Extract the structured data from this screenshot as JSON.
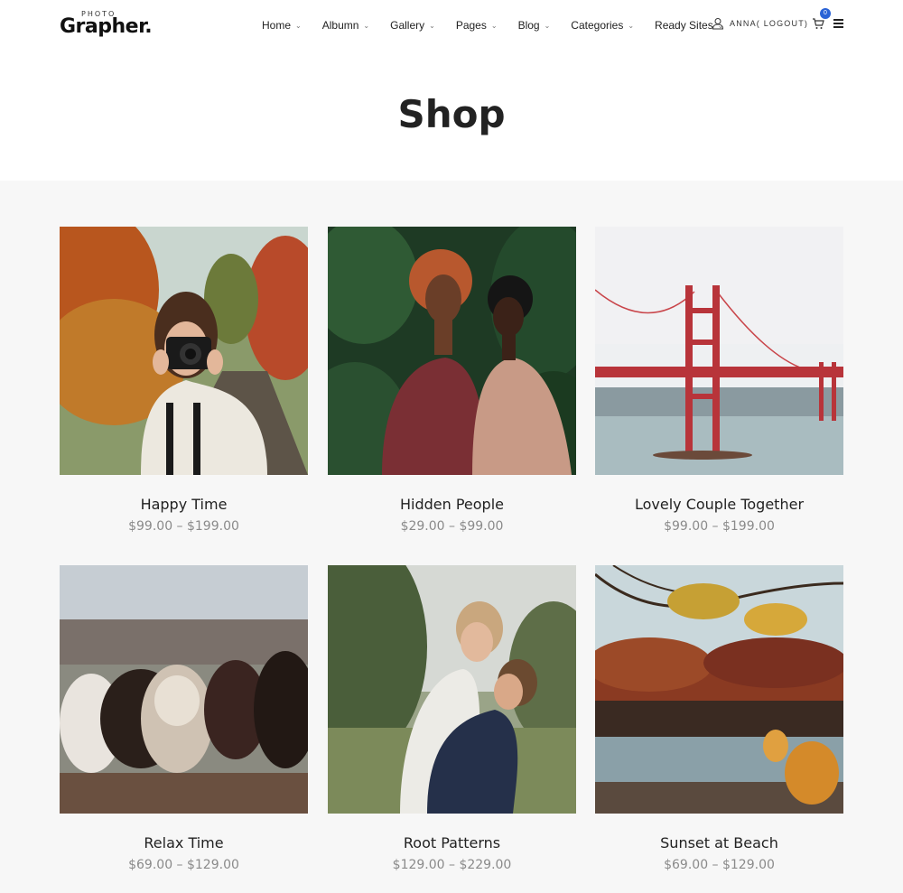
{
  "brand": {
    "small": "PHOTO",
    "name": "Grapher."
  },
  "nav": [
    {
      "label": "Home"
    },
    {
      "label": "Albumn"
    },
    {
      "label": "Gallery"
    },
    {
      "label": "Pages"
    },
    {
      "label": "Blog"
    },
    {
      "label": "Categories"
    },
    {
      "label": "Ready Sites"
    }
  ],
  "user": {
    "label": "ANNA( LOGOUT)"
  },
  "cart": {
    "count": "0"
  },
  "page": {
    "title": "Shop"
  },
  "products": [
    {
      "name": "Happy Time",
      "price": "$99.00 – $199.00",
      "icon": "photo-woman-camera"
    },
    {
      "name": "Hidden People",
      "price": "$29.00 – $99.00",
      "icon": "photo-couple-jungle"
    },
    {
      "name": "Lovely Couple Together",
      "price": "$99.00 – $199.00",
      "icon": "photo-golden-gate-bridge"
    },
    {
      "name": "Relax Time",
      "price": "$69.00 – $129.00",
      "icon": "photo-cows"
    },
    {
      "name": "Root Patterns",
      "price": "$129.00 – $229.00",
      "icon": "photo-couple-hug"
    },
    {
      "name": "Sunset at Beach",
      "price": "$69.00 – $129.00",
      "icon": "photo-autumn-lake"
    }
  ],
  "colors": {
    "accent": "#2a63d6",
    "background": "#f7f7f7",
    "price": "#8a8a8a"
  }
}
